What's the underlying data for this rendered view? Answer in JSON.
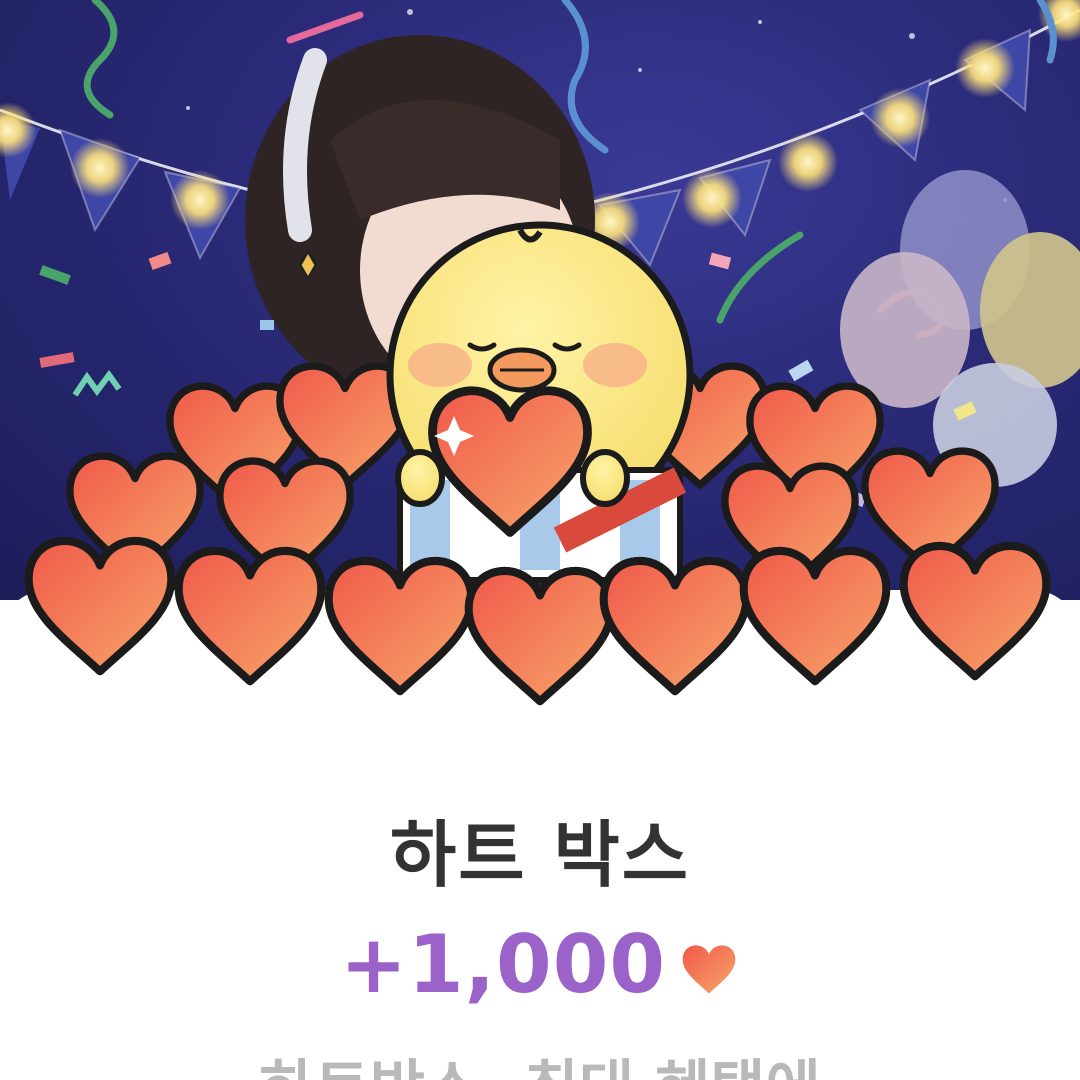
{
  "reward_card": {
    "title": "하트 박스",
    "amount": "+1,000",
    "description": "하트박스, 최대 혜택에"
  },
  "icons": {
    "reward_icon": "heart-icon",
    "mascot": "chick-mascot-with-heart",
    "banner_decor": [
      "bunting-flags",
      "string-lights",
      "balloons",
      "confetti",
      "streamers"
    ]
  },
  "colors": {
    "background_banner": "#2a2a78",
    "amount": "#9b63c9",
    "title": "#333333",
    "heart_fill": "#ef6f4e",
    "description": "#b9b9b9"
  }
}
